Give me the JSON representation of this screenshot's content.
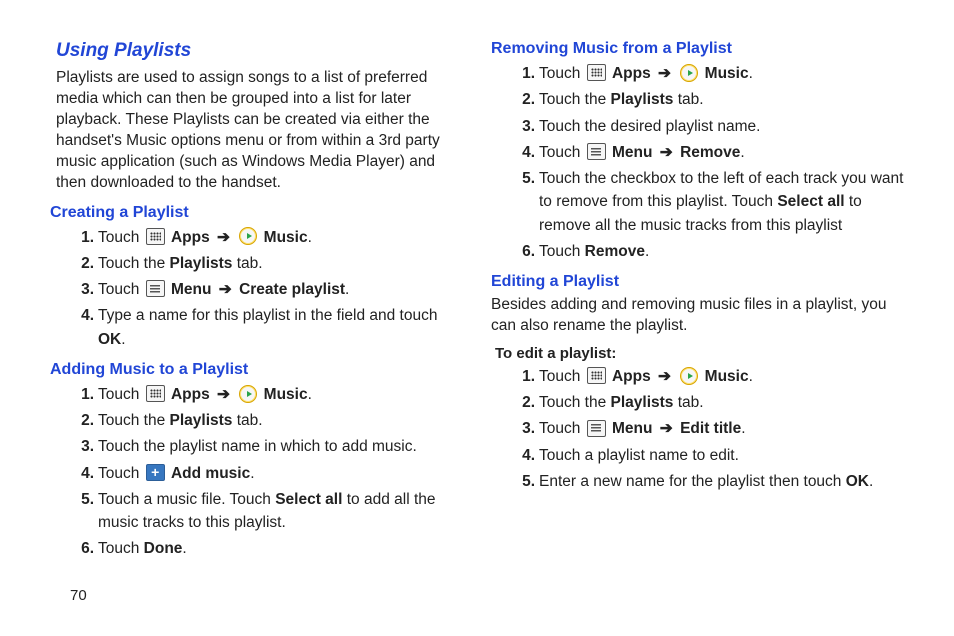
{
  "page_number": "70",
  "left": {
    "h_using": "Using Playlists",
    "intro": "Playlists are used to assign songs to a list of preferred media which can then be grouped into a list for later playback. These Playlists can be created via either the handset's Music options menu or from within a 3rd party music application (such as Windows Media Player) and then downloaded to the handset.",
    "creating_h": "Creating a Playlist",
    "creating": {
      "s1_touch": "Touch ",
      "s1_apps": "Apps",
      "s1_music": "Music",
      "s2a": "Touch the ",
      "s2b": "Playlists",
      "s2c": " tab.",
      "s3_touch": "Touch ",
      "s3_menu": "Menu",
      "s3_cp": "Create playlist",
      "s4a": "Type a name for this playlist in the field and touch ",
      "s4b": "OK",
      "period": "."
    },
    "adding_h": "Adding Music to a Playlist",
    "adding": {
      "s1_touch": "Touch ",
      "s1_apps": "Apps",
      "s1_music": "Music",
      "s2a": "Touch the ",
      "s2b": "Playlists",
      "s2c": " tab.",
      "s3": "Touch the playlist name in which to add music.",
      "s4_touch": "Touch ",
      "s4_add": "Add music",
      "s5a": "Touch a music file. Touch ",
      "s5b": "Select all",
      "s5c": " to add all the music tracks to this playlist.",
      "s6a": "Touch ",
      "s6b": "Done",
      "period": "."
    }
  },
  "right": {
    "removing_h": "Removing Music from a Playlist",
    "removing": {
      "s1_touch": "Touch ",
      "s1_apps": "Apps",
      "s1_music": "Music",
      "s2a": "Touch the ",
      "s2b": "Playlists",
      "s2c": " tab.",
      "s3": "Touch the desired playlist name.",
      "s4_touch": "Touch ",
      "s4_menu": "Menu",
      "s4_remove": "Remove",
      "s5a": "Touch the checkbox to the left of each track you want to remove from this playlist. Touch ",
      "s5b": "Select all",
      "s5c": " to remove all the music tracks from this playlist",
      "s6a": "Touch ",
      "s6b": "Remove",
      "period": "."
    },
    "editing_h": "Editing a Playlist",
    "editing_intro": "Besides adding and removing music files in a playlist, you can also rename the playlist.",
    "editing_lead": "To edit a playlist:",
    "editing": {
      "s1_touch": "Touch ",
      "s1_apps": "Apps",
      "s1_music": "Music",
      "s2a": "Touch the ",
      "s2b": "Playlists",
      "s2c": " tab.",
      "s3_touch": "Touch ",
      "s3_menu": "Menu",
      "s3_edit": "Edit title",
      "s4": "Touch a playlist name to edit.",
      "s5a": "Enter a new name for the playlist then touch ",
      "s5b": "OK",
      "period": "."
    }
  },
  "arrow": "➔"
}
